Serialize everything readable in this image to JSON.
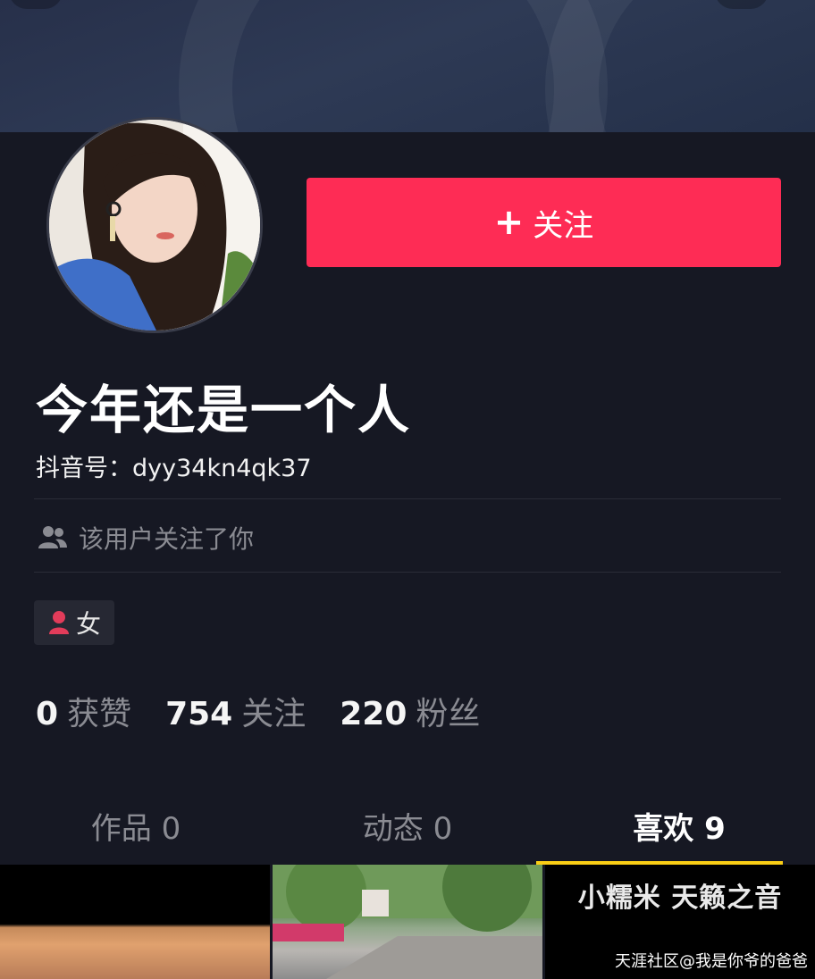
{
  "profile": {
    "follow_label": "关注",
    "nickname": "今年还是一个人",
    "douyin_id": "抖音号：dyy34kn4qk37",
    "follows_you_text": "该用户关注了你",
    "gender": "女"
  },
  "stats": [
    {
      "value": "0",
      "label": "获赞"
    },
    {
      "value": "754",
      "label": "关注"
    },
    {
      "value": "220",
      "label": "粉丝"
    }
  ],
  "tabs": [
    {
      "label": "作品 0"
    },
    {
      "label": "动态 0"
    },
    {
      "label": "喜欢 9"
    }
  ],
  "grid": {
    "caption": "小糯米 天籁之音"
  },
  "watermark": "天涯社区@我是你爷的爸爸",
  "colors": {
    "background": "#161823",
    "follow_button": "#fe2c55",
    "tab_indicator": "#face15",
    "muted_text": "#8a8b92"
  },
  "icons": {
    "follow": "plus-icon",
    "follows_you": "users-icon",
    "gender": "female-icon"
  }
}
